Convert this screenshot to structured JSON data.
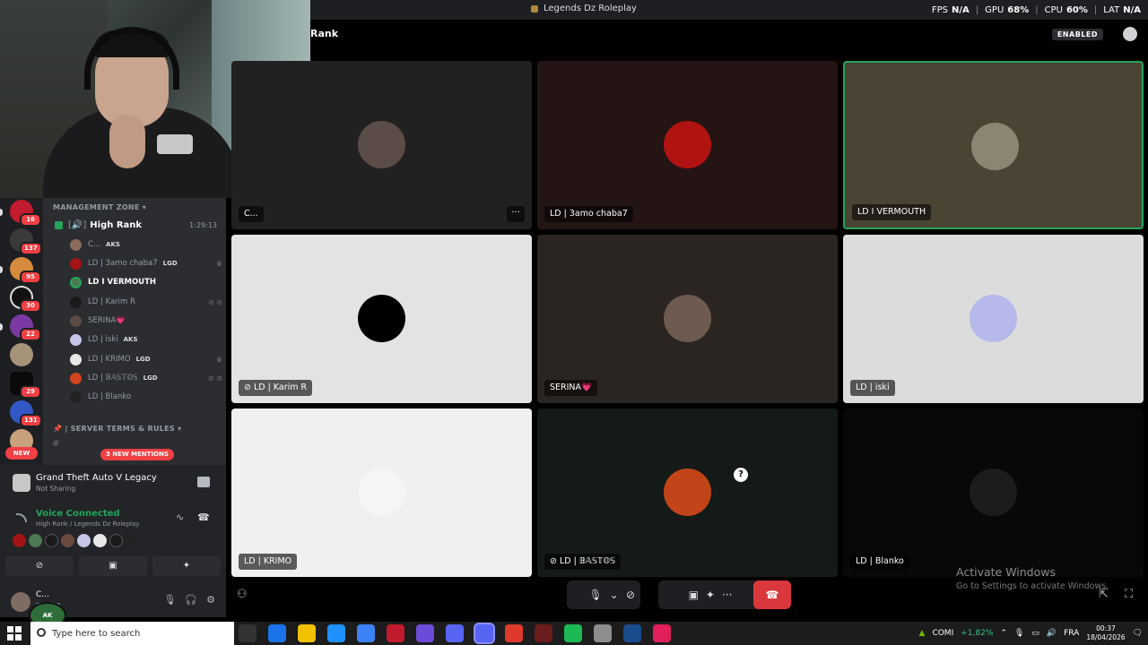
{
  "window": {
    "title": "Legends Dz Roleplay"
  },
  "perf": [
    {
      "label": "FPS",
      "value": "N/A"
    },
    {
      "label": "GPU",
      "value": "68%"
    },
    {
      "label": "CPU",
      "value": "60%"
    },
    {
      "label": "LAT",
      "value": "N/A"
    }
  ],
  "call": {
    "channel_name": "Rank",
    "enabled_label": "ENABLED"
  },
  "rail": {
    "badges": [
      "16",
      "137",
      "95",
      "30",
      "22",
      "29",
      "131"
    ],
    "new_label": "NEW"
  },
  "channels": {
    "category": "MANAGEMENT ZONE",
    "voice_channel": {
      "name": "High Rank",
      "prefix": "[🔊]",
      "elapsed": "1:29:13"
    },
    "members": [
      {
        "name": "C...",
        "tag": "AKS",
        "color": "#8a6b5e"
      },
      {
        "name": "LD | 3amo chaba7",
        "tag": "LGD",
        "color": "#a31414"
      },
      {
        "name": "LD I VERMOUTH",
        "tag": "",
        "color": "#6d7a5c"
      },
      {
        "name": "LD | Karim R",
        "tag": "",
        "color": "#1a1a1a"
      },
      {
        "name": "SERINA💗",
        "tag": "",
        "color": "#5a4b44"
      },
      {
        "name": "LD | iski",
        "tag": "AKS",
        "color": "#c5c6e8"
      },
      {
        "name": "LD | KRIMO",
        "tag": "LGD",
        "color": "#e8e8e8"
      },
      {
        "name": "LD | 𝔹𝔸𝕊𝕋𝕆𝕊",
        "tag": "LGD",
        "color": "#d2441e"
      },
      {
        "name": "LD | Blanko",
        "tag": "",
        "color": "#222"
      }
    ],
    "rules_category": "| SERVER TERMS & RULES",
    "mentions": "3 NEW MENTIONS"
  },
  "activity": {
    "game": "Grand Theft Auto V Legacy",
    "status": "Not Sharing"
  },
  "voice": {
    "status": "Voice Connected",
    "location": "High Rank / Legends Dz Roleplay",
    "avatar_colors": [
      "#a31414",
      "#4d7a52",
      "#1a1a1a",
      "#6a4a40",
      "#c5c6e8",
      "#e8e8e8",
      "#1a1a1a",
      "#222"
    ]
  },
  "user": {
    "name": "C...",
    "status": "In voice"
  },
  "tiles": [
    {
      "label": "C...",
      "bg": "#212121",
      "av": "#5b4c47",
      "more": "···"
    },
    {
      "label": "LD | 3amo chaba7",
      "bg": "#241414",
      "av": "#b11313"
    },
    {
      "label": "LD I VERMOUTH",
      "bg": "#4a4435",
      "av": "#8c8574",
      "speaking": true
    },
    {
      "label": "LD | Karim R",
      "bg": "#e3e3e3",
      "av": "#000000",
      "muted": true
    },
    {
      "label": "SERINA💗",
      "bg": "#2a2520",
      "av": "#6e5a4e"
    },
    {
      "label": "LD | iski",
      "bg": "#dcdcdc",
      "av": "#b7b9ea"
    },
    {
      "label": "LD | KRIMO",
      "bg": "#f0f0f0",
      "av": "#f5f5f5"
    },
    {
      "label": "LD | 𝔹𝔸𝕊𝕋𝕆𝕊",
      "bg": "#141a18",
      "av": "#c24419",
      "muted": true
    },
    {
      "label": "LD | Blanko",
      "bg": "#080808",
      "av": "#1c1c1c"
    }
  ],
  "watermark": {
    "title": "Activate Windows",
    "subtitle": "Go to Settings to activate Windows."
  },
  "taskbar": {
    "search_placeholder": "Type here to search",
    "stock_name": "COMI",
    "stock_change": "+1,82%",
    "lang": "FRA",
    "time": "00:37",
    "date": "18/04/2026",
    "app_colors": [
      "#333",
      "#1a73e8",
      "#f2c200",
      "#1e90ff",
      "#3b82f6",
      "#c21a2e",
      "#6c4bd8",
      "#5865f2",
      "#5865f2",
      "#dd3a2c",
      "#6b1c1c",
      "#1db954",
      "#8d8d8d",
      "#1a4b8c",
      "#e01f5b"
    ]
  },
  "colors": {
    "accent_green": "#23a55a",
    "alert_red": "#f23f43",
    "hangup": "#da373c"
  }
}
